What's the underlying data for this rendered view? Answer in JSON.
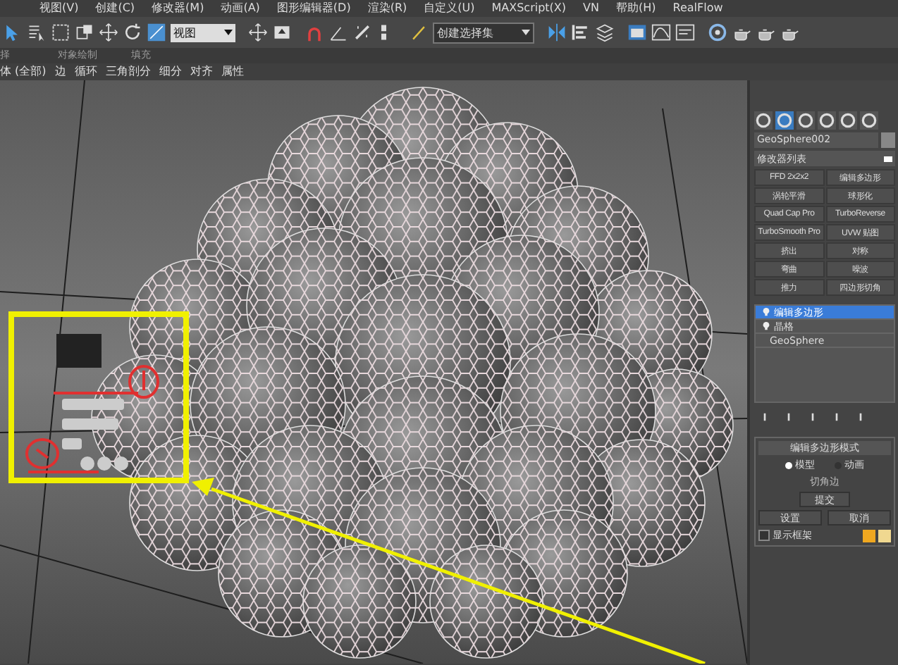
{
  "menu": [
    "视图(V)",
    "创建(C)",
    "修改器(M)",
    "动画(A)",
    "图形编辑器(D)",
    "渲染(R)",
    "自定义(U)",
    "MAXScript(X)",
    "VN",
    "帮助(H)",
    "RealFlow"
  ],
  "toolbar": {
    "view_dropdown": "视图",
    "selection_set": "创建选择集"
  },
  "ribbon_tabs": [
    "择",
    "对象绘制",
    "填充"
  ],
  "ribbon_tools": [
    "体 (全部)",
    "边",
    "循环",
    "三角剖分",
    "细分",
    "对齐",
    "属性"
  ],
  "panel": {
    "object_name": "GeoSphere002",
    "modifier_list": "修改器列表",
    "modifier_buttons": [
      "FFD 2x2x2",
      "编辑多边形",
      "涡轮平滑",
      "球形化",
      "Quad Cap Pro",
      "TurboReverse",
      "TurboSmooth Pro",
      "UVW 贴图",
      "挤出",
      "对称",
      "弯曲",
      "噪波",
      "推力",
      "四边形切角"
    ],
    "stack": [
      {
        "label": "编辑多边形",
        "selected": true,
        "kind": "modifier"
      },
      {
        "label": "晶格",
        "selected": false,
        "kind": "modifier"
      },
      {
        "label": "GeoSphere",
        "selected": false,
        "kind": "object"
      }
    ],
    "rollout": {
      "title": "编辑多边形模式",
      "modes": [
        {
          "label": "模型",
          "selected": true
        },
        {
          "label": "动画",
          "selected": false
        }
      ],
      "operation": "切角边",
      "commit": "提交",
      "settings": "设置",
      "cancel": "取消",
      "show_cage": {
        "label": "显示框架",
        "checked": false
      },
      "cage_colors": [
        {
          "color": "#f0a820"
        },
        {
          "color": "#f0d890"
        }
      ]
    }
  }
}
